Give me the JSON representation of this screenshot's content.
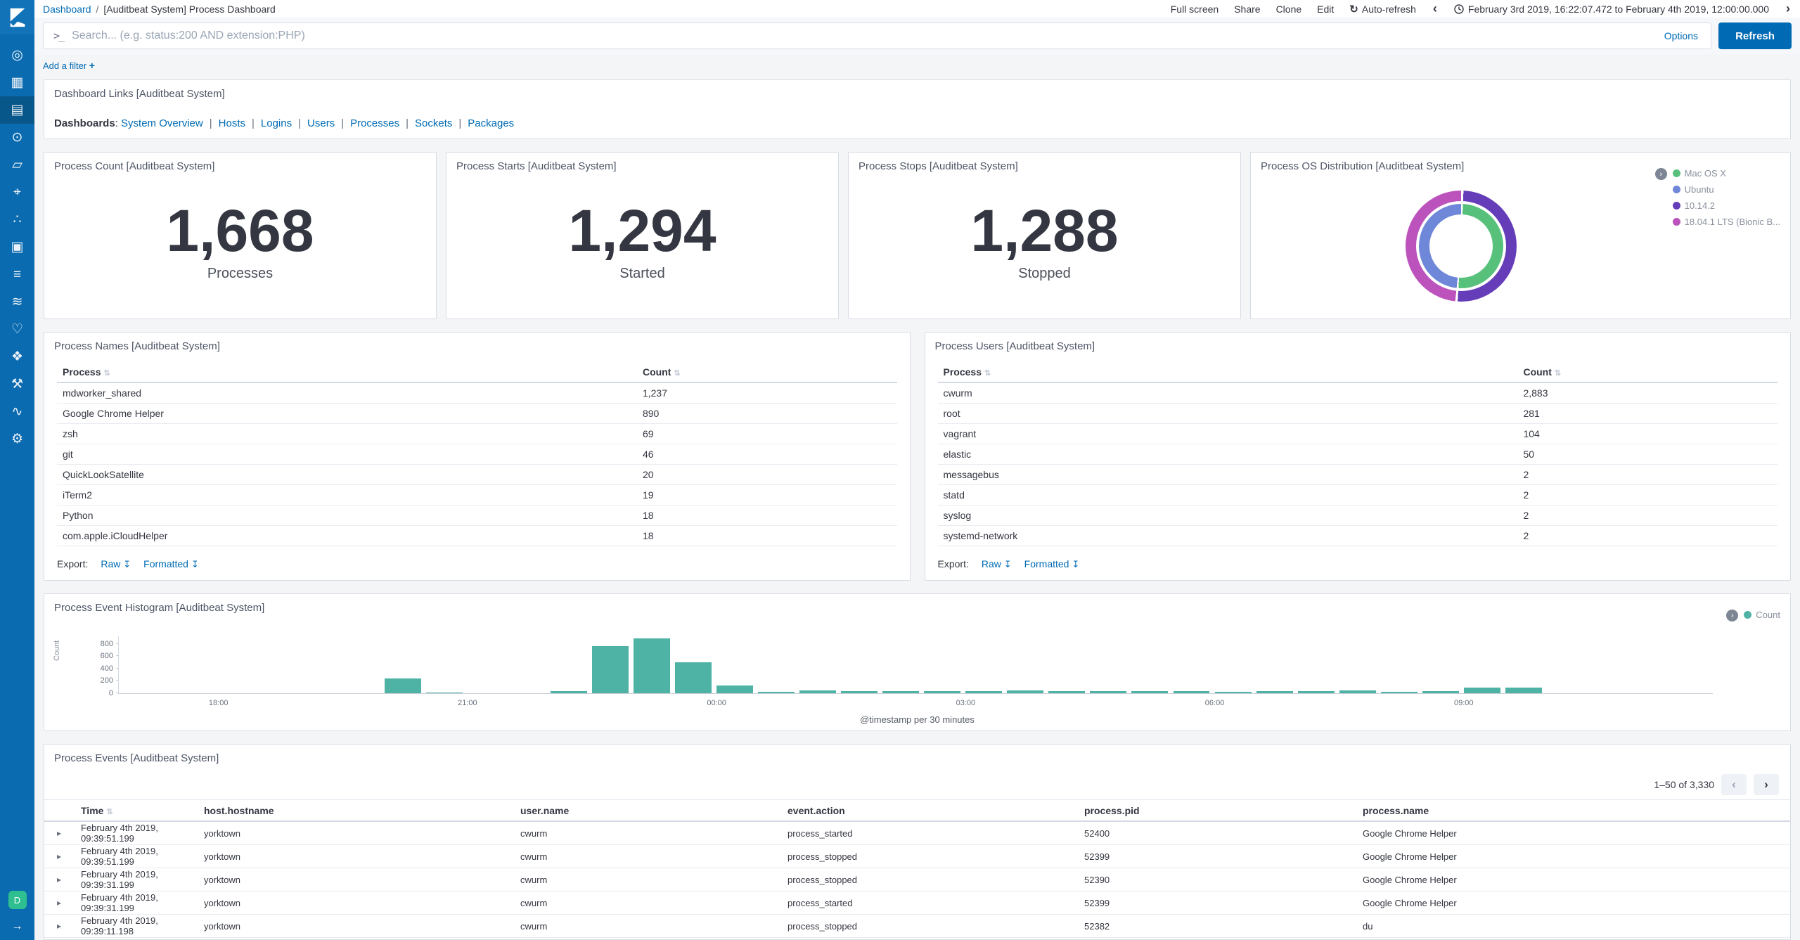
{
  "colors": {
    "accent": "#006bb4",
    "sidebar": "#0b6bb0",
    "sidebar_logo": "#1273b8",
    "sidebar_active": "#085687",
    "avatar_green": "#2fbe8f",
    "histogram_teal": "#4eb3a5"
  },
  "sidebar": {
    "items": [
      {
        "name": "discover",
        "glyph": "◎",
        "active": false
      },
      {
        "name": "visualize",
        "glyph": "▦",
        "active": false
      },
      {
        "name": "dashboard",
        "glyph": "▤",
        "active": true
      },
      {
        "name": "timelion",
        "glyph": "⊙",
        "active": false
      },
      {
        "name": "canvas",
        "glyph": "▱",
        "active": false
      },
      {
        "name": "maps",
        "glyph": "⌖",
        "active": false
      },
      {
        "name": "machine-learning",
        "glyph": "∴",
        "active": false
      },
      {
        "name": "infrastructure",
        "glyph": "▣",
        "active": false
      },
      {
        "name": "logs",
        "glyph": "≡",
        "active": false
      },
      {
        "name": "apm",
        "glyph": "≋",
        "active": false
      },
      {
        "name": "uptime",
        "glyph": "♡",
        "active": false
      },
      {
        "name": "graph",
        "glyph": "❖",
        "active": false
      },
      {
        "name": "dev-tools",
        "glyph": "⚒",
        "active": false
      },
      {
        "name": "monitoring",
        "glyph": "∿",
        "active": false
      },
      {
        "name": "management",
        "glyph": "⚙",
        "active": false
      }
    ],
    "avatar_label": "D",
    "collapse_arrow": "→"
  },
  "header": {
    "breadcrumb_root": "Dashboard",
    "breadcrumb_sep": "/",
    "breadcrumb_current": "[Auditbeat System] Process Dashboard",
    "actions": [
      "Full screen",
      "Share",
      "Clone",
      "Edit"
    ],
    "auto_refresh_icon": "↻",
    "auto_refresh_label": "Auto-refresh",
    "prev_chevron": "‹",
    "next_chevron": "›",
    "time_range": "February 3rd 2019, 16:22:07.472 to February 4th 2019, 12:00:00.000"
  },
  "search_bar": {
    "prompt_icon": ">_",
    "placeholder": "Search... (e.g. status:200 AND extension:PHP)",
    "value": "",
    "options_label": "Options",
    "refresh_label": "Refresh"
  },
  "filter_bar": {
    "add_filter_label": "Add a filter",
    "plus_icon": "+"
  },
  "links_panel": {
    "title": "Dashboard Links [Auditbeat System]",
    "prefix": "Dashboards",
    "separator": "|",
    "links": [
      "System Overview",
      "Hosts",
      "Logins",
      "Users",
      "Processes",
      "Sockets",
      "Packages"
    ]
  },
  "metrics": [
    {
      "title": "Process Count [Auditbeat System]",
      "value": "1,668",
      "label": "Processes"
    },
    {
      "title": "Process Starts [Auditbeat System]",
      "value": "1,294",
      "label": "Started"
    },
    {
      "title": "Process Stops [Auditbeat System]",
      "value": "1,288",
      "label": "Stopped"
    }
  ],
  "os_panel": {
    "title": "Process OS Distribution [Auditbeat System]",
    "legend_toggle_icon": "›",
    "legend": [
      {
        "label": "Mac OS X",
        "color": "#57c17b"
      },
      {
        "label": "Ubuntu",
        "color": "#6f87d8"
      },
      {
        "label": "10.14.2",
        "color": "#663db8"
      },
      {
        "label": "18.04.1 LTS (Bionic B...",
        "color": "#bc52bc"
      }
    ]
  },
  "stats_tables": [
    {
      "title": "Process Names [Auditbeat System]",
      "columns": [
        "Process",
        "Count"
      ],
      "sort_icon": "⇅",
      "rows": [
        [
          "mdworker_shared",
          "1,237"
        ],
        [
          "Google Chrome Helper",
          "890"
        ],
        [
          "zsh",
          "69"
        ],
        [
          "git",
          "46"
        ],
        [
          "QuickLookSatellite",
          "20"
        ],
        [
          "iTerm2",
          "19"
        ],
        [
          "Python",
          "18"
        ],
        [
          "com.apple.iCloudHelper",
          "18"
        ]
      ],
      "export_label": "Export:",
      "export_links": [
        "Raw",
        "Formatted"
      ],
      "download_icon": "↧"
    },
    {
      "title": "Process Users [Auditbeat System]",
      "columns": [
        "Process",
        "Count"
      ],
      "sort_icon": "⇅",
      "rows": [
        [
          "cwurm",
          "2,883"
        ],
        [
          "root",
          "281"
        ],
        [
          "vagrant",
          "104"
        ],
        [
          "elastic",
          "50"
        ],
        [
          "messagebus",
          "2"
        ],
        [
          "statd",
          "2"
        ],
        [
          "syslog",
          "2"
        ],
        [
          "systemd-network",
          "2"
        ]
      ],
      "export_label": "Export:",
      "export_links": [
        "Raw",
        "Formatted"
      ],
      "download_icon": "↧"
    }
  ],
  "histogram_panel": {
    "title": "Process Event Histogram [Auditbeat System]",
    "legend_toggle_icon": "›",
    "legend_label": "Count"
  },
  "events_panel": {
    "title": "Process Events [Auditbeat System]",
    "pagination": "1–50 of 3,330",
    "prev_icon": "‹",
    "next_icon": "›",
    "expander_icon": "▸",
    "time_sort_icon": "⇅",
    "columns": [
      "Time",
      "host.hostname",
      "user.name",
      "event.action",
      "process.pid",
      "process.name"
    ],
    "rows": [
      [
        "February 4th 2019, 09:39:51.199",
        "yorktown",
        "cwurm",
        "process_started",
        "52400",
        "Google Chrome Helper"
      ],
      [
        "February 4th 2019, 09:39:51.199",
        "yorktown",
        "cwurm",
        "process_stopped",
        "52399",
        "Google Chrome Helper"
      ],
      [
        "February 4th 2019, 09:39:31.199",
        "yorktown",
        "cwurm",
        "process_stopped",
        "52390",
        "Google Chrome Helper"
      ],
      [
        "February 4th 2019, 09:39:31.199",
        "yorktown",
        "cwurm",
        "process_started",
        "52399",
        "Google Chrome Helper"
      ],
      [
        "February 4th 2019, 09:39:11.198",
        "yorktown",
        "cwurm",
        "process_stopped",
        "52382",
        "du"
      ]
    ]
  },
  "chart_data": [
    {
      "type": "bar",
      "title": "Process Event Histogram [Auditbeat System]",
      "xlabel": "@timestamp per 30 minutes",
      "ylabel": "Count",
      "legend_position": "top-right",
      "legend": [
        "Count"
      ],
      "grid": false,
      "ylim": [
        0,
        920
      ],
      "yticks": [
        0,
        200,
        400,
        600,
        800
      ],
      "x_domain_hours": [
        16.8,
        36
      ],
      "xticks": [
        {
          "h": 18,
          "label": "18:00"
        },
        {
          "h": 21,
          "label": "21:00"
        },
        {
          "h": 24,
          "label": "00:00"
        },
        {
          "h": 27,
          "label": "03:00"
        },
        {
          "h": 30,
          "label": "06:00"
        },
        {
          "h": 33,
          "label": "09:00"
        }
      ],
      "bucket_minutes": 30,
      "series": [
        {
          "name": "Count",
          "color": "#4eb3a5",
          "points": [
            {
              "h": 20.0,
              "v": 235
            },
            {
              "h": 20.5,
              "v": 12
            },
            {
              "h": 22.0,
              "v": 30
            },
            {
              "h": 22.5,
              "v": 760
            },
            {
              "h": 23.0,
              "v": 890
            },
            {
              "h": 23.5,
              "v": 495
            },
            {
              "h": 24.0,
              "v": 130
            },
            {
              "h": 24.5,
              "v": 28
            },
            {
              "h": 25.0,
              "v": 45
            },
            {
              "h": 25.5,
              "v": 38
            },
            {
              "h": 26.0,
              "v": 33
            },
            {
              "h": 26.5,
              "v": 38
            },
            {
              "h": 27.0,
              "v": 35
            },
            {
              "h": 27.5,
              "v": 40
            },
            {
              "h": 28.0,
              "v": 35
            },
            {
              "h": 28.5,
              "v": 35
            },
            {
              "h": 29.0,
              "v": 33
            },
            {
              "h": 29.5,
              "v": 38
            },
            {
              "h": 30.0,
              "v": 28
            },
            {
              "h": 30.5,
              "v": 35
            },
            {
              "h": 31.0,
              "v": 38
            },
            {
              "h": 31.5,
              "v": 40
            },
            {
              "h": 32.0,
              "v": 25
            },
            {
              "h": 32.5,
              "v": 33
            },
            {
              "h": 33.0,
              "v": 95
            },
            {
              "h": 33.5,
              "v": 95
            }
          ]
        }
      ]
    },
    {
      "type": "pie",
      "title": "Process OS Distribution [Auditbeat System]",
      "donut": true,
      "rings": [
        {
          "name": "os-name",
          "slices": [
            {
              "label": "Mac OS X",
              "value": 51,
              "color": "#57c17b"
            },
            {
              "label": "Ubuntu",
              "value": 49,
              "color": "#6f87d8"
            }
          ]
        },
        {
          "name": "os-version",
          "slices": [
            {
              "label": "10.14.2",
              "value": 51,
              "color": "#663db8"
            },
            {
              "label": "18.04.1 LTS (Bionic B...",
              "value": 49,
              "color": "#bc52bc"
            }
          ]
        }
      ]
    }
  ]
}
